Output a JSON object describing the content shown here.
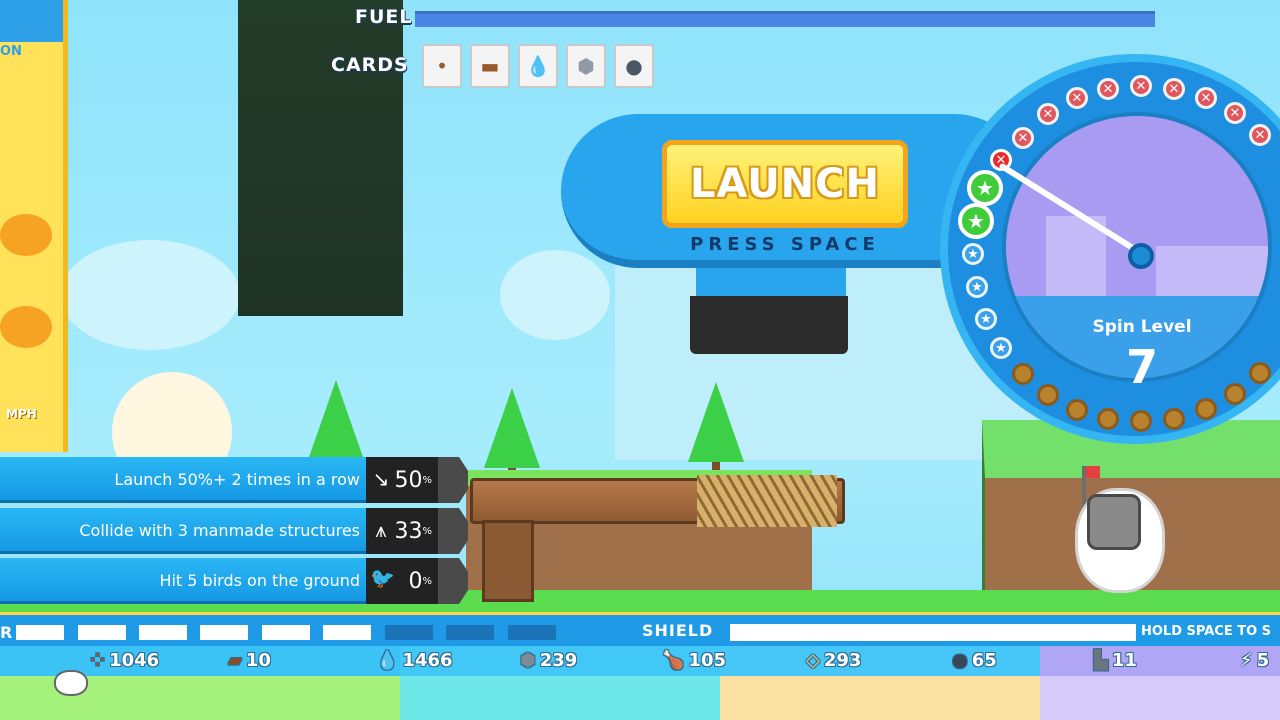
{
  "hud": {
    "fuel_label": "FUEL",
    "cards_label": "CARDS",
    "fuel_level": 1.0,
    "cards": [
      {
        "icon": "seeds-card-icon",
        "glyph": "•"
      },
      {
        "icon": "log-card-icon",
        "glyph": "▬"
      },
      {
        "icon": "water-card-icon",
        "glyph": "💧"
      },
      {
        "icon": "stone-card-icon",
        "glyph": "⬢"
      },
      {
        "icon": "oil-card-icon",
        "glyph": "●"
      }
    ]
  },
  "left_panel": {
    "top_label": "ON",
    "speed_unit": "MPH"
  },
  "launch": {
    "button_label": "LAUNCH",
    "hint": "PRESS SPACE"
  },
  "spin": {
    "label": "Spin Level",
    "value": "7"
  },
  "goals": [
    {
      "text": "Launch 50%+ 2 times in a row",
      "value": "50",
      "unit": "%",
      "icon": "launch-streak-icon",
      "glyph": "↘"
    },
    {
      "text": "Collide with 3 manmade structures",
      "value": "33",
      "unit": "%",
      "icon": "oil-rig-icon",
      "glyph": "⩚"
    },
    {
      "text": "Hit 5 birds on the ground",
      "value": "0",
      "unit": "%",
      "icon": "bird-icon",
      "glyph": "🐦"
    }
  ],
  "bottom": {
    "left_mark": "R",
    "shield_label": "SHIELD",
    "shield_level": 1.0,
    "hold_hint": "HOLD SPACE TO S",
    "segments_filled": 6,
    "segments_total": 9
  },
  "resources": [
    {
      "icon": "seeds-icon",
      "glyph": "⁘",
      "value": "1046"
    },
    {
      "icon": "log-icon",
      "glyph": "▰",
      "value": "10"
    },
    {
      "icon": "water-drop-icon",
      "glyph": "💧",
      "value": "1466"
    },
    {
      "icon": "stone-icon",
      "glyph": "⬢",
      "value": "239"
    },
    {
      "icon": "meat-icon",
      "glyph": "🍗",
      "value": "105"
    },
    {
      "icon": "sand-icon",
      "glyph": "◇",
      "value": "293"
    },
    {
      "icon": "oil-drop-icon",
      "glyph": "●",
      "value": "65"
    },
    {
      "icon": "anvil-icon",
      "glyph": "▙",
      "value": "11"
    },
    {
      "icon": "lightning-icon",
      "glyph": "⚡",
      "value": "5"
    }
  ],
  "colors": {
    "sky": "#8fe3fb",
    "accent_blue": "#29a5ee",
    "launch_yellow": "#ffd21f",
    "grass": "#5bdc4f"
  }
}
